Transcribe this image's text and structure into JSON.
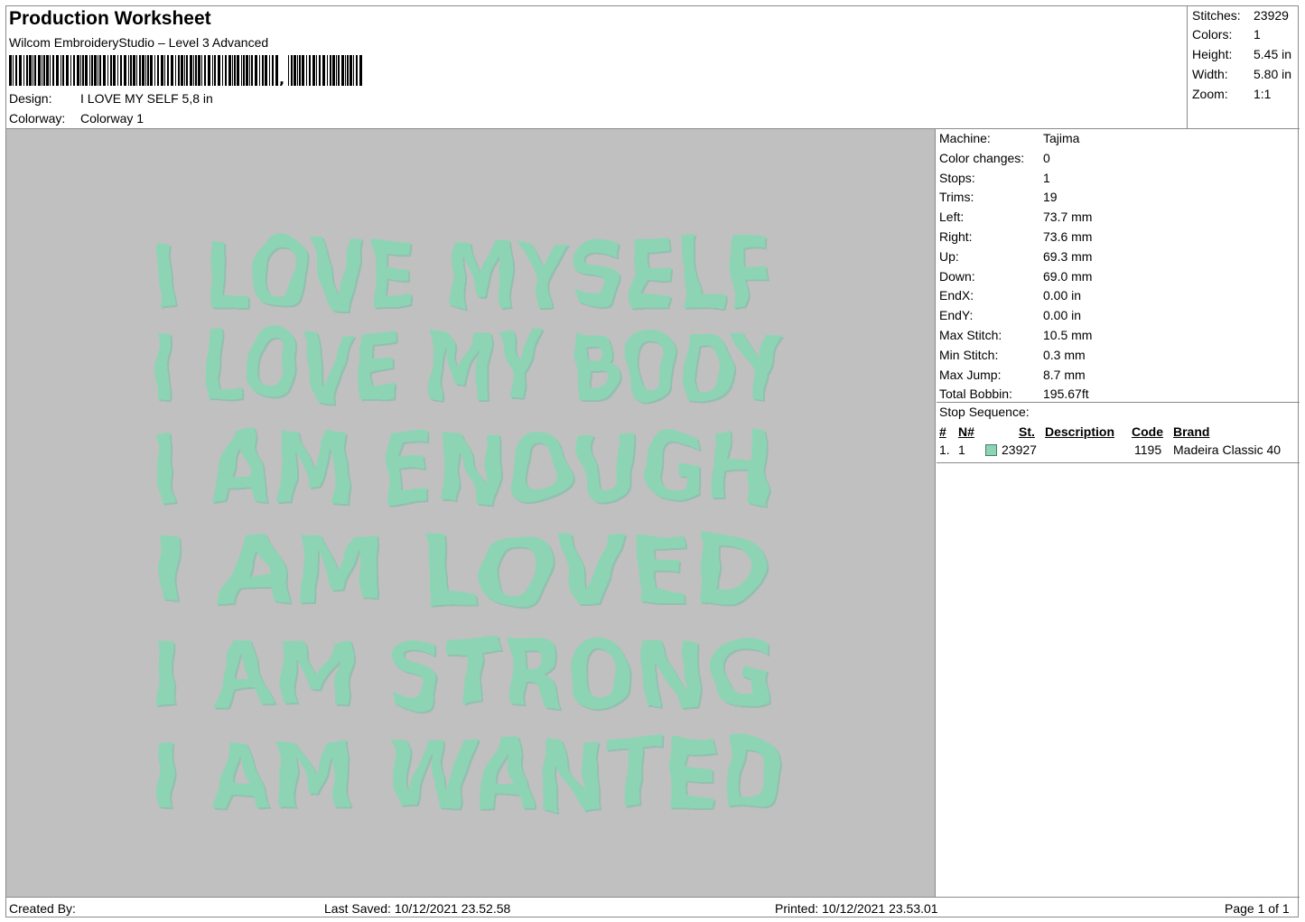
{
  "header": {
    "title": "Production Worksheet",
    "software": "Wilcom EmbroideryStudio – Level 3 Advanced",
    "design_label": "Design:",
    "design_value": "I LOVE MY SELF 5,8 in",
    "colorway_label": "Colorway:",
    "colorway_value": "Colorway 1"
  },
  "stats": {
    "stitches_label": "Stitches:",
    "stitches_value": "23929",
    "colors_label": "Colors:",
    "colors_value": "1",
    "height_label": "Height:",
    "height_value": "5.45 in",
    "width_label": "Width:",
    "width_value": "5.80 in",
    "zoom_label": "Zoom:",
    "zoom_value": "1:1"
  },
  "design_preview": {
    "background_color": "#c0c0c0",
    "thread_color": "#8dd4b5",
    "lines": [
      "I LOVE MYSELF",
      "I LOVE MY BODY",
      "I AM ENOUGH",
      "I AM LOVED",
      "I AM STRONG",
      "I AM WANTED"
    ]
  },
  "machine_info": [
    {
      "label": "Machine:",
      "value": "Tajima"
    },
    {
      "label": "Color changes:",
      "value": "0"
    },
    {
      "label": "Stops:",
      "value": "1"
    },
    {
      "label": "Trims:",
      "value": "19"
    },
    {
      "label": "Left:",
      "value": "73.7 mm"
    },
    {
      "label": "Right:",
      "value": "73.6 mm"
    },
    {
      "label": "Up:",
      "value": "69.3 mm"
    },
    {
      "label": "Down:",
      "value": "69.0 mm"
    },
    {
      "label": "EndX:",
      "value": "0.00 in"
    },
    {
      "label": "EndY:",
      "value": "0.00 in"
    },
    {
      "label": "Max Stitch:",
      "value": "10.5 mm"
    },
    {
      "label": "Min Stitch:",
      "value": "0.3 mm"
    },
    {
      "label": "Max Jump:",
      "value": "8.7 mm"
    },
    {
      "label": "Total Bobbin:",
      "value": "195.67ft"
    }
  ],
  "stop_sequence": {
    "title": "Stop Sequence:",
    "columns": [
      "#",
      "N#",
      "St.",
      "Description",
      "Code",
      "Brand"
    ],
    "rows": [
      {
        "index": "1.",
        "n": "1",
        "swatch_color": "#8dd4b5",
        "stitches": "23927",
        "description": "",
        "code": "1195",
        "brand": "Madeira Classic 40"
      }
    ]
  },
  "footer": {
    "created_by": "Created By:",
    "last_saved": "Last Saved: 10/12/2021 23.52.58",
    "printed": "Printed: 10/12/2021 23.53.01",
    "page": "Page 1 of 1"
  }
}
